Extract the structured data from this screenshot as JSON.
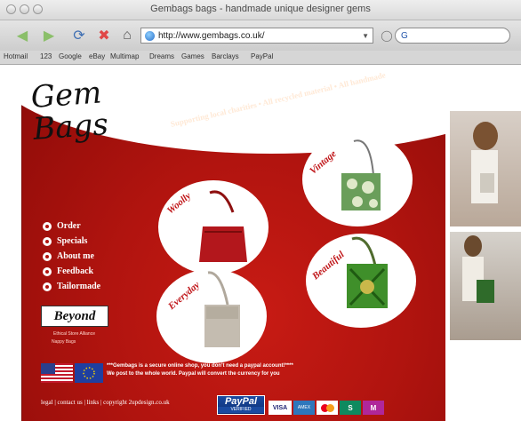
{
  "window": {
    "title": "Gembags bags - handmade unique designer gems"
  },
  "toolbar": {
    "url": "http://www.gembags.co.uk/",
    "search_value": "G"
  },
  "bookmarks": [
    "Hotmail",
    "123",
    "Google",
    "eBay",
    "Multimap",
    "Dreams",
    "Games",
    "Barclays",
    "PayPal"
  ],
  "site": {
    "logo": {
      "line1": "Gem",
      "line2": "Bags"
    },
    "tagline": "Supporting local charities • All recycled material • All handmade",
    "bags": [
      {
        "label": "Woolly"
      },
      {
        "label": "Vintage"
      },
      {
        "label": "Everyday"
      },
      {
        "label": "Beautiful"
      }
    ],
    "nav": [
      "Order",
      "Specials",
      "About me",
      "Feedback",
      "Tailormade"
    ],
    "partner": {
      "name": "Beyond",
      "line1": "Ethical Store Alliance",
      "line2": "Nappy Bags"
    },
    "notice": {
      "line1": "***Gembags is a secure online shop, you don't need a paypal account!****",
      "line2": "We post to the whole world. Paypal will convert the currency for you"
    },
    "footer": "legal  |  contact us  |  links  |  copyright 2updesign.co.uk",
    "paypal": {
      "label": "PayPal",
      "sub": "VERIFIED"
    },
    "cards": [
      "VISA",
      "AMEX",
      "MC",
      "S",
      "M"
    ]
  },
  "colors": {
    "brand_red": "#b1140f",
    "link_white": "#ffffff"
  }
}
